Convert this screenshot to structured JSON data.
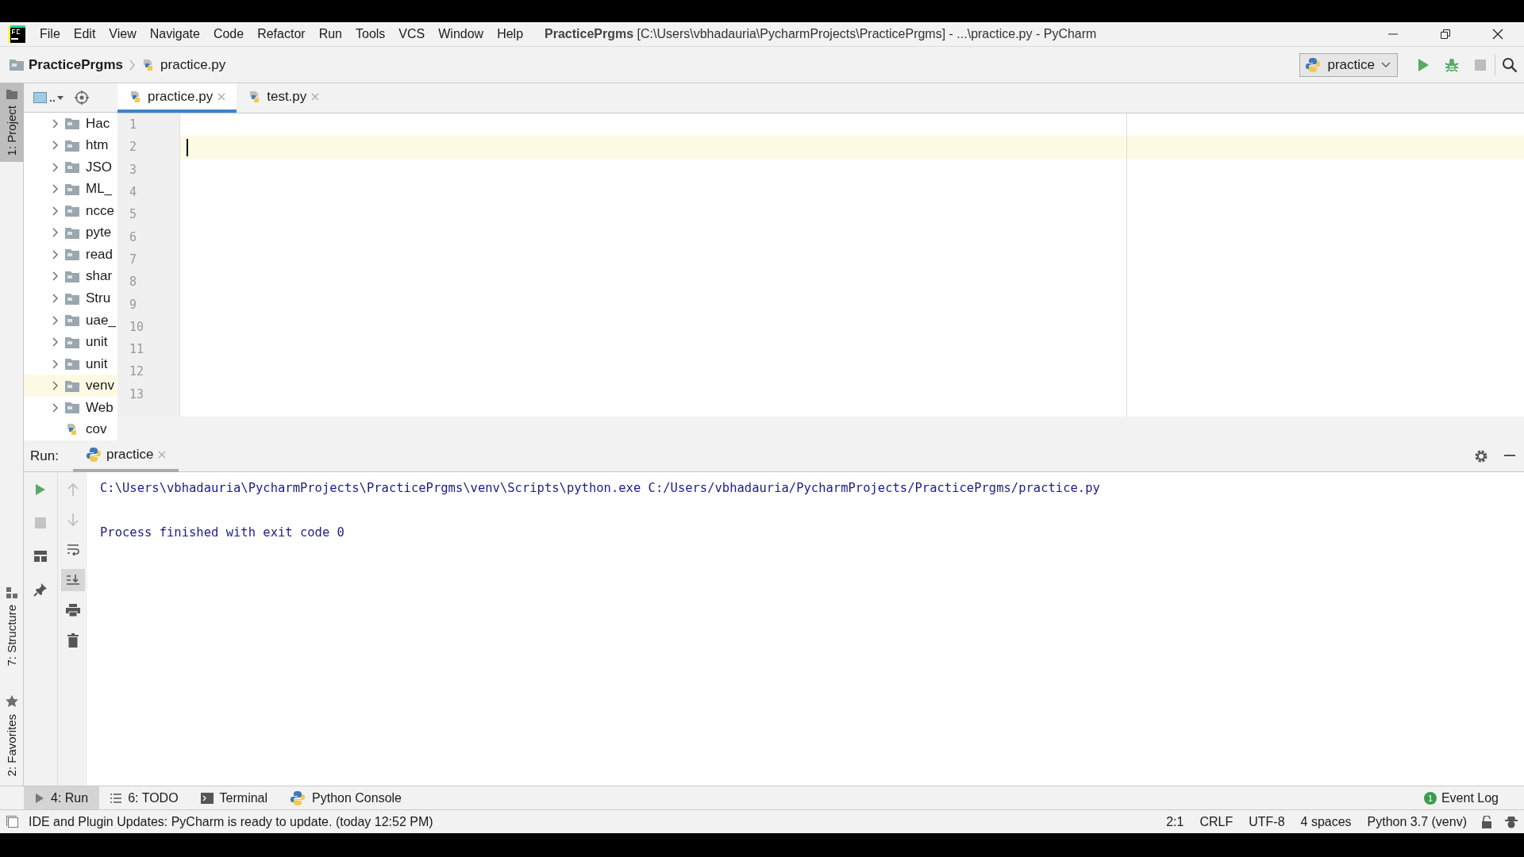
{
  "window": {
    "project": "PracticePrgms",
    "title": "[C:\\Users\\vbhadauria\\PycharmProjects\\PracticePrgms] - ...\\practice.py - PyCharm"
  },
  "menu": [
    "File",
    "Edit",
    "View",
    "Navigate",
    "Code",
    "Refactor",
    "Run",
    "Tools",
    "VCS",
    "Window",
    "Help"
  ],
  "breadcrumbs": [
    {
      "label": "PracticePrgms",
      "kind": "folder"
    },
    {
      "label": "practice.py",
      "kind": "python"
    }
  ],
  "run_config": {
    "name": "practice"
  },
  "side_tabs": [
    {
      "label": "1: Project",
      "kind": "project",
      "selected": true
    },
    {
      "label": "7: Structure",
      "kind": "structure",
      "selected": false
    },
    {
      "label": "2: Favorites",
      "kind": "favorites",
      "selected": false
    }
  ],
  "project_tree": [
    {
      "name": "Hac",
      "kind": "folder",
      "selected": false
    },
    {
      "name": "htm",
      "kind": "folder",
      "selected": false
    },
    {
      "name": "JSO",
      "kind": "folder",
      "selected": false
    },
    {
      "name": "ML_",
      "kind": "folder",
      "selected": false
    },
    {
      "name": "ncce",
      "kind": "folder",
      "selected": false
    },
    {
      "name": "pyte",
      "kind": "folder",
      "selected": false
    },
    {
      "name": "read",
      "kind": "folder",
      "selected": false
    },
    {
      "name": "shar",
      "kind": "folder",
      "selected": false
    },
    {
      "name": "Stru",
      "kind": "folder",
      "selected": false
    },
    {
      "name": "uae_",
      "kind": "folder",
      "selected": false
    },
    {
      "name": "unit",
      "kind": "folder",
      "selected": false
    },
    {
      "name": "unit",
      "kind": "folder",
      "selected": false
    },
    {
      "name": "venv",
      "kind": "folder",
      "selected": true
    },
    {
      "name": "Web",
      "kind": "folder",
      "selected": false
    },
    {
      "name": "cov",
      "kind": "file",
      "selected": false
    }
  ],
  "editor": {
    "tabs": [
      {
        "label": "practice.py",
        "selected": true
      },
      {
        "label": "test.py",
        "selected": false
      }
    ],
    "lines": [
      {
        "number": "1",
        "current": false
      },
      {
        "number": "2",
        "current": true
      },
      {
        "number": "3",
        "current": false
      },
      {
        "number": "4",
        "current": false
      },
      {
        "number": "5",
        "current": false
      },
      {
        "number": "6",
        "current": false
      },
      {
        "number": "7",
        "current": false
      },
      {
        "number": "8",
        "current": false
      },
      {
        "number": "9",
        "current": false
      },
      {
        "number": "10",
        "current": false
      },
      {
        "number": "11",
        "current": false
      },
      {
        "number": "12",
        "current": false
      },
      {
        "number": "13",
        "current": false
      }
    ]
  },
  "run_panel": {
    "label": "Run:",
    "tabs": [
      {
        "label": "practice",
        "selected": true
      }
    ],
    "output": [
      {
        "text": "C:\\Users\\vbhadauria\\PycharmProjects\\PracticePrgms\\venv\\Scripts\\python.exe C:/Users/vbhadauria/PycharmProjects/PracticePrgms/practice.py",
        "kind": "command"
      },
      {
        "text": "Process finished with exit code 0",
        "kind": "result"
      }
    ]
  },
  "tool_tabs": [
    {
      "label": "4: Run",
      "kind": "run",
      "selected": true
    },
    {
      "label": "6: TODO",
      "kind": "todo",
      "selected": false
    },
    {
      "label": "Terminal",
      "kind": "terminal",
      "selected": false
    },
    {
      "label": "Python Console",
      "kind": "console",
      "selected": false
    }
  ],
  "event_log": {
    "label": "Event Log",
    "count": "1"
  },
  "status_bar": {
    "message": "IDE and Plugin Updates: PyCharm is ready to update. (today 12:52 PM)",
    "items": [
      "2:1",
      "CRLF",
      "UTF-8",
      "4 spaces",
      "Python 3.7 (venv)"
    ]
  }
}
